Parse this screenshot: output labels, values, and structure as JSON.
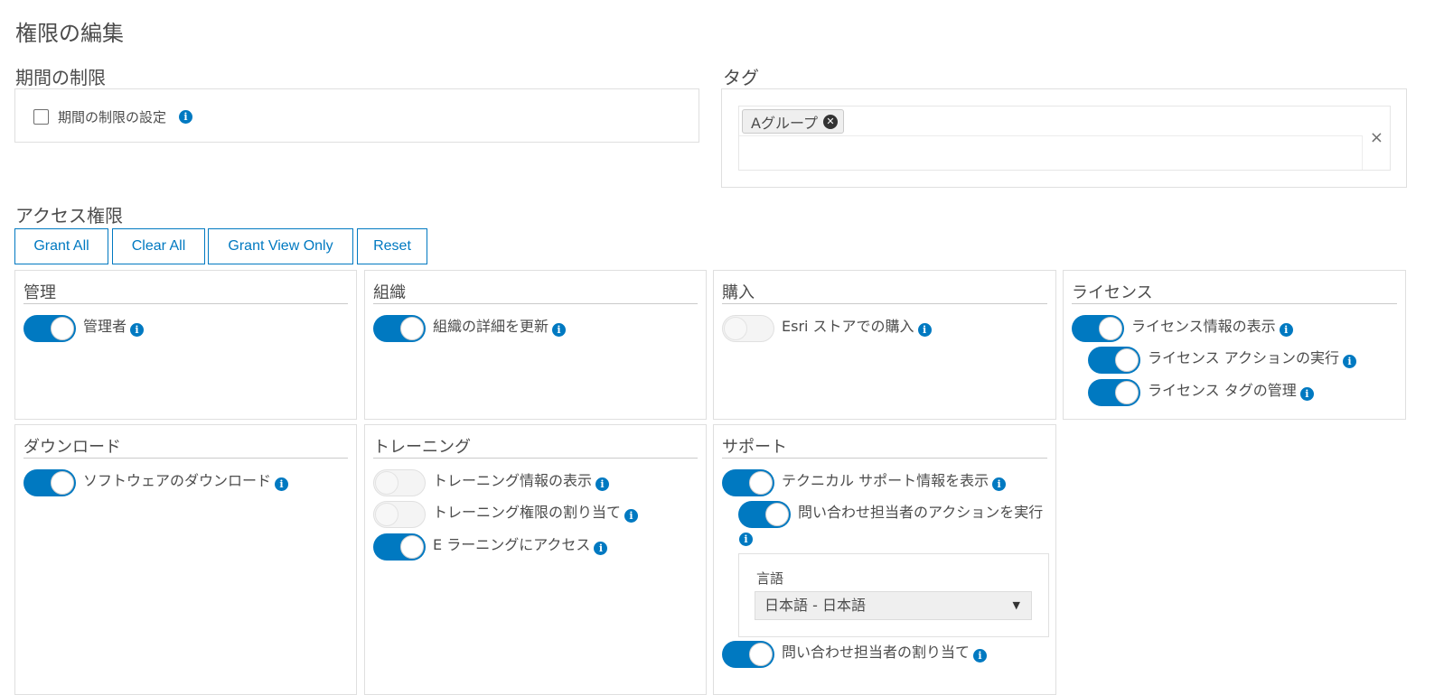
{
  "page_title": "権限の編集",
  "time_limit": {
    "title": "期間の制限",
    "checkbox_label": "期間の制限の設定",
    "checked": false
  },
  "tags": {
    "title": "タグ",
    "items": [
      {
        "label": "Aグループ"
      }
    ],
    "clear_icon": "×"
  },
  "access": {
    "title": "アクセス権限",
    "buttons": {
      "grant_all": "Grant All",
      "clear_all": "Clear All",
      "grant_view_only": "Grant View Only",
      "reset": "Reset"
    }
  },
  "cards": {
    "admin": {
      "title": "管理",
      "items": [
        {
          "label": "管理者",
          "on": true
        }
      ]
    },
    "org": {
      "title": "組織",
      "items": [
        {
          "label": "組織の詳細を更新",
          "on": true
        }
      ]
    },
    "purchase": {
      "title": "購入",
      "items": [
        {
          "label": "Esri ストアでの購入",
          "on": false
        }
      ]
    },
    "license": {
      "title": "ライセンス",
      "items": [
        {
          "label": "ライセンス情報の表示",
          "on": true
        },
        {
          "label": "ライセンス アクションの実行",
          "on": true
        },
        {
          "label": "ライセンス タグの管理",
          "on": true
        }
      ]
    },
    "download": {
      "title": "ダウンロード",
      "items": [
        {
          "label": "ソフトウェアのダウンロード",
          "on": true
        }
      ]
    },
    "training": {
      "title": "トレーニング",
      "items": [
        {
          "label": "トレーニング情報の表示",
          "on": false
        },
        {
          "label": "トレーニング権限の割り当て",
          "on": false
        },
        {
          "label": "E ラーニングにアクセス",
          "on": true
        }
      ]
    },
    "support": {
      "title": "サポート",
      "items": [
        {
          "label": "テクニカル サポート情報を表示",
          "on": true
        },
        {
          "label": "問い合わせ担当者のアクションを実行",
          "on": true
        },
        {
          "label": "問い合わせ担当者の割り当て",
          "on": true
        }
      ],
      "language_label": "言語",
      "language_value": "日本語 - 日本語"
    }
  },
  "colors": {
    "accent": "#0079c1",
    "border": "#dfdfdf",
    "text": "#4c4c4c"
  },
  "icons": {
    "info": "info-icon",
    "remove": "remove-tag-icon",
    "clear": "clear-icon",
    "dropdown": "chevron-down-icon"
  }
}
